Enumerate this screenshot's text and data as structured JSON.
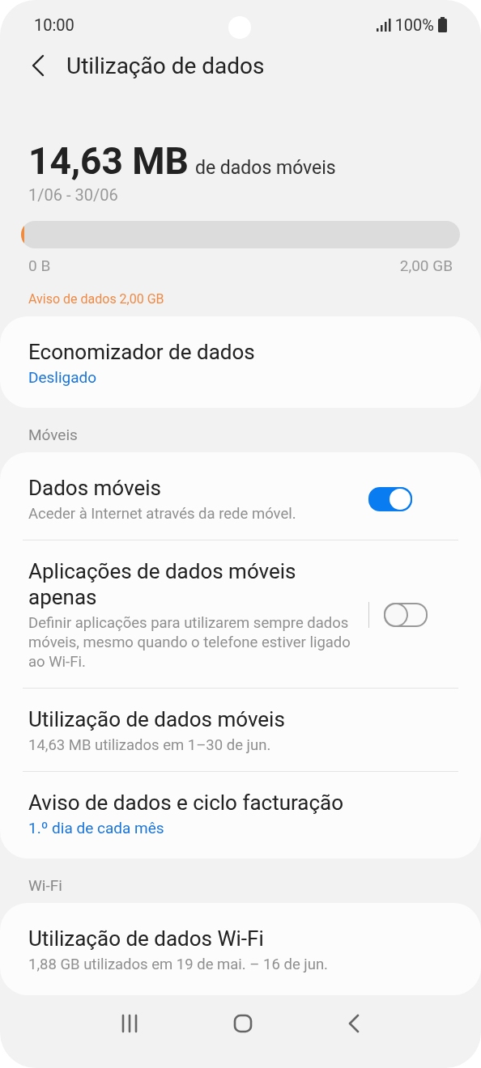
{
  "status_bar": {
    "time": "10:00",
    "battery": "100%"
  },
  "header": {
    "title": "Utilização de dados"
  },
  "usage": {
    "amount": "14,63 MB",
    "unit_label": "de dados móveis",
    "period": "1/06 - 30/06",
    "level": 0.007,
    "min_label": "0 B",
    "max_label": "2,00 GB",
    "warning": "Aviso de dados 2,00 GB"
  },
  "sections": [
    {
      "items": [
        {
          "kind": "value",
          "title": "Economizador de dados",
          "value": "Desligado"
        }
      ]
    },
    {
      "heading": "Móveis",
      "items": [
        {
          "kind": "toggle",
          "title": "Dados móveis",
          "description": "Aceder à Internet através da rede móvel.",
          "on": true,
          "separated": false
        },
        {
          "kind": "toggle",
          "title": "Aplicações de dados móveis apenas",
          "description": "Definir aplicações para utilizarem sempre dados móveis, mesmo quando o telefone estiver ligado ao Wi-Fi.",
          "on": false,
          "separated": true
        },
        {
          "kind": "info",
          "title": "Utilização de dados móveis",
          "description": "14,63 MB utilizados em 1–30 de jun."
        },
        {
          "kind": "value",
          "title": "Aviso de dados e ciclo facturação",
          "value": "1.º dia de cada mês"
        }
      ]
    },
    {
      "heading": "Wi-Fi",
      "items": [
        {
          "kind": "info",
          "title": "Utilização de dados Wi-Fi",
          "description": "1,88 GB utilizados em 19 de mai. – 16 de jun."
        }
      ]
    }
  ]
}
